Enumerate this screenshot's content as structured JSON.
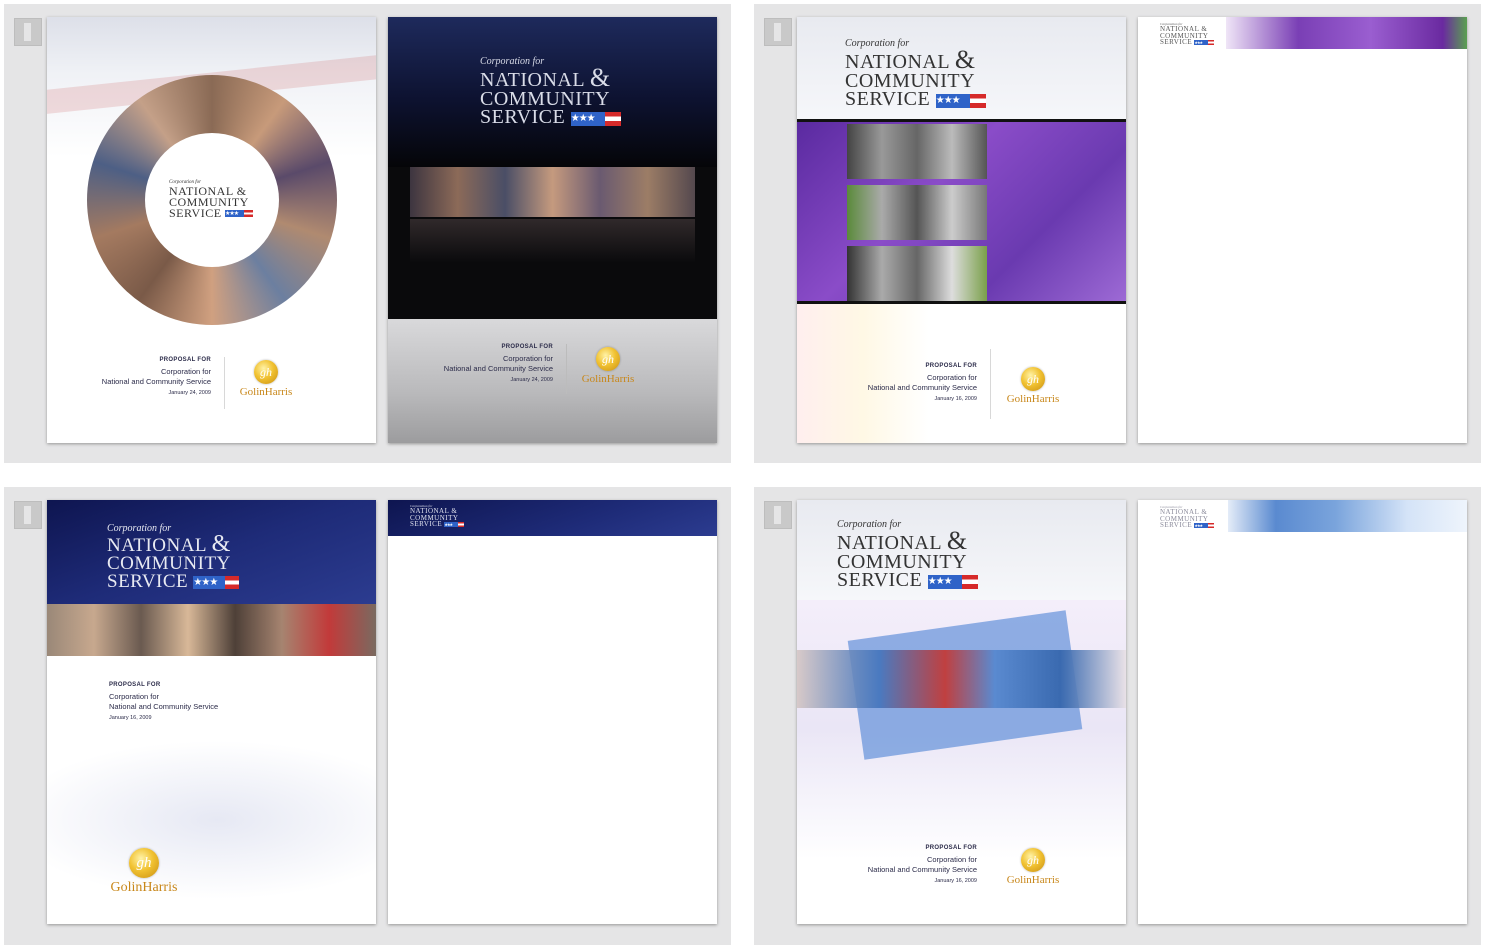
{
  "brand": {
    "corp_for": "Corporation for",
    "line1": "NATIONAL",
    "amp": "&",
    "line2": "COMMUNITY",
    "line3": "SERVICE",
    "stars": "★★★",
    "colors": {
      "navy": "#131b5c",
      "flag_blue": "#2f63c8",
      "flag_red": "#d62a2a",
      "gold": "#c8871a",
      "purple": "#7a3fb5"
    }
  },
  "proposal": {
    "proposal_for": "PROPOSAL FOR",
    "org_line1": "Corporation for",
    "org_line2": "National and Community Service",
    "date_a": "January 24, 2009",
    "date_b": "January 16, 2009"
  },
  "agency": {
    "monogram": "gh",
    "name": "GolinHarris"
  },
  "icons": {
    "corner": "page-number-icon",
    "flag": "flag-icon"
  }
}
